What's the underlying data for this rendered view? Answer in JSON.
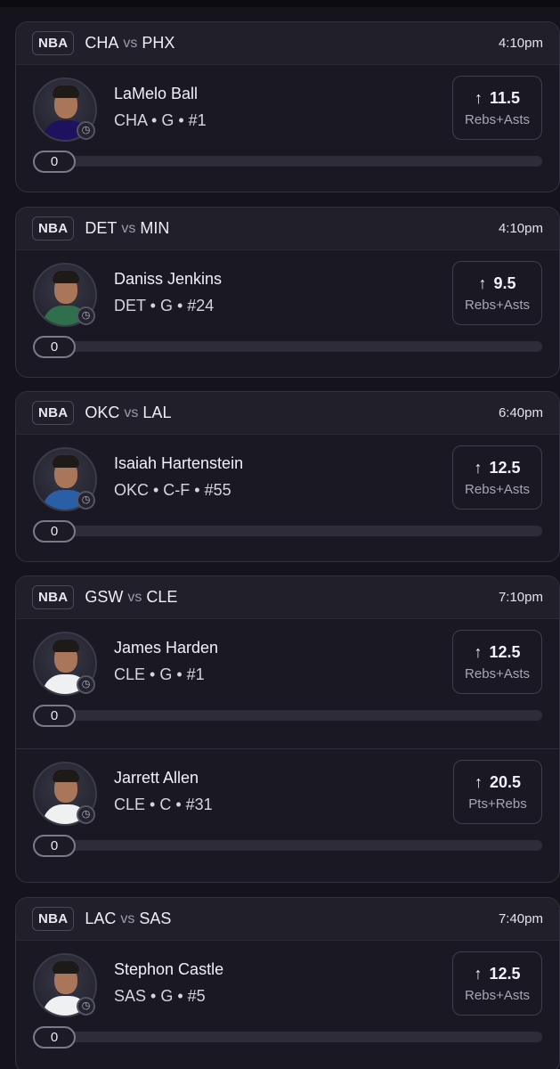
{
  "games": [
    {
      "league": "NBA",
      "team_a": "CHA",
      "vs": "vs",
      "team_b": "PHX",
      "time": "4:10pm",
      "players": [
        {
          "name": "LaMelo Ball",
          "info": "CHA • G • #1",
          "line": "11.5",
          "stat": "Rebs+Asts",
          "progress": "0",
          "jersey_color": "#1d1160"
        }
      ]
    },
    {
      "league": "NBA",
      "team_a": "DET",
      "vs": "vs",
      "team_b": "MIN",
      "time": "4:10pm",
      "players": [
        {
          "name": "Daniss Jenkins",
          "info": "DET • G • #24",
          "line": "9.5",
          "stat": "Rebs+Asts",
          "progress": "0",
          "jersey_color": "#2f6f4d"
        }
      ]
    },
    {
      "league": "NBA",
      "team_a": "OKC",
      "vs": "vs",
      "team_b": "LAL",
      "time": "6:40pm",
      "players": [
        {
          "name": "Isaiah Hartenstein",
          "info": "OKC • C-F • #55",
          "line": "12.5",
          "stat": "Rebs+Asts",
          "progress": "0",
          "jersey_color": "#2a5fa8"
        }
      ]
    },
    {
      "league": "NBA",
      "team_a": "GSW",
      "vs": "vs",
      "team_b": "CLE",
      "time": "7:10pm",
      "players": [
        {
          "name": "James Harden",
          "info": "CLE • G • #1",
          "line": "12.5",
          "stat": "Rebs+Asts",
          "progress": "0",
          "jersey_color": "#eef0f2"
        },
        {
          "name": "Jarrett Allen",
          "info": "CLE • C • #31",
          "line": "20.5",
          "stat": "Pts+Rebs",
          "progress": "0",
          "jersey_color": "#eef0f2"
        }
      ]
    },
    {
      "league": "NBA",
      "team_a": "LAC",
      "vs": "vs",
      "team_b": "SAS",
      "time": "7:40pm",
      "players": [
        {
          "name": "Stephon Castle",
          "info": "SAS • G • #5",
          "line": "12.5",
          "stat": "Rebs+Asts",
          "progress": "0",
          "jersey_color": "#eef0f2"
        }
      ]
    }
  ],
  "icons": {
    "arrow": "arrow-up-icon",
    "clock": "clock-icon",
    "avatar": "player-avatar"
  },
  "colors": {
    "background": "#15141d",
    "card": "#1a1923",
    "header": "#201f2a",
    "border": "#33323e"
  }
}
